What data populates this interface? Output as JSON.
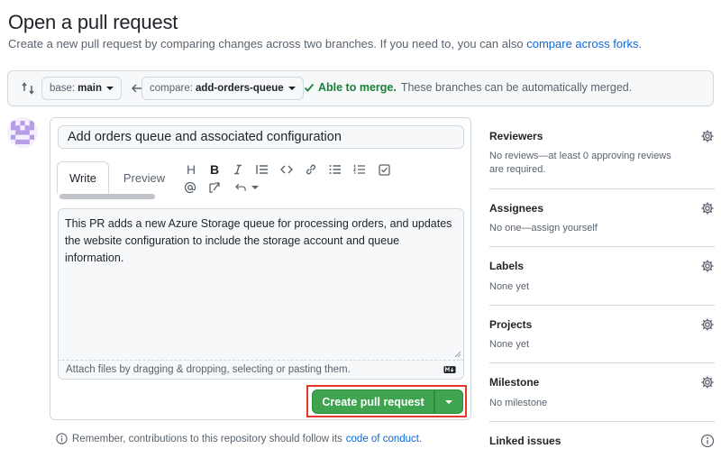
{
  "header": {
    "title": "Open a pull request",
    "subtitle_prefix": "Create a new pull request by comparing changes across two branches. If you need to, you can also ",
    "subtitle_link": "compare across forks",
    "subtitle_suffix": "."
  },
  "compare": {
    "base_prefix": "base:",
    "base_branch": "main",
    "compare_prefix": "compare:",
    "compare_branch": "add-orders-queue",
    "merge_status": "Able to merge.",
    "merge_description": "These branches can be automatically merged."
  },
  "editor": {
    "title_value": "Add orders queue and associated configuration",
    "tabs": {
      "write": "Write",
      "preview": "Preview"
    },
    "body": "This PR adds a new Azure Storage queue for processing orders, and updates the website configuration to include the storage account and queue information.",
    "attach_hint": "Attach files by dragging & dropping, selecting or pasting them.",
    "toolbar": {
      "heading": "H",
      "bold": "B"
    }
  },
  "actions": {
    "create_label": "Create pull request"
  },
  "footer": {
    "remember_text": "Remember, contributions to this repository should follow its",
    "remember_link": "code of conduct",
    "remember_suffix": "."
  },
  "sidebar": {
    "reviewers": {
      "title": "Reviewers",
      "text": "No reviews—at least 0 approving reviews are required."
    },
    "assignees": {
      "title": "Assignees",
      "text": "No one—assign yourself"
    },
    "labels": {
      "title": "Labels",
      "text": "None yet"
    },
    "projects": {
      "title": "Projects",
      "text": "None yet"
    },
    "milestone": {
      "title": "Milestone",
      "text": "No milestone"
    },
    "linked_issues": {
      "title": "Linked issues"
    }
  },
  "colors": {
    "accent_link": "#0969da",
    "success": "#1a7f37",
    "button_green": "#3ea44f",
    "highlight_red": "#e5382c"
  }
}
